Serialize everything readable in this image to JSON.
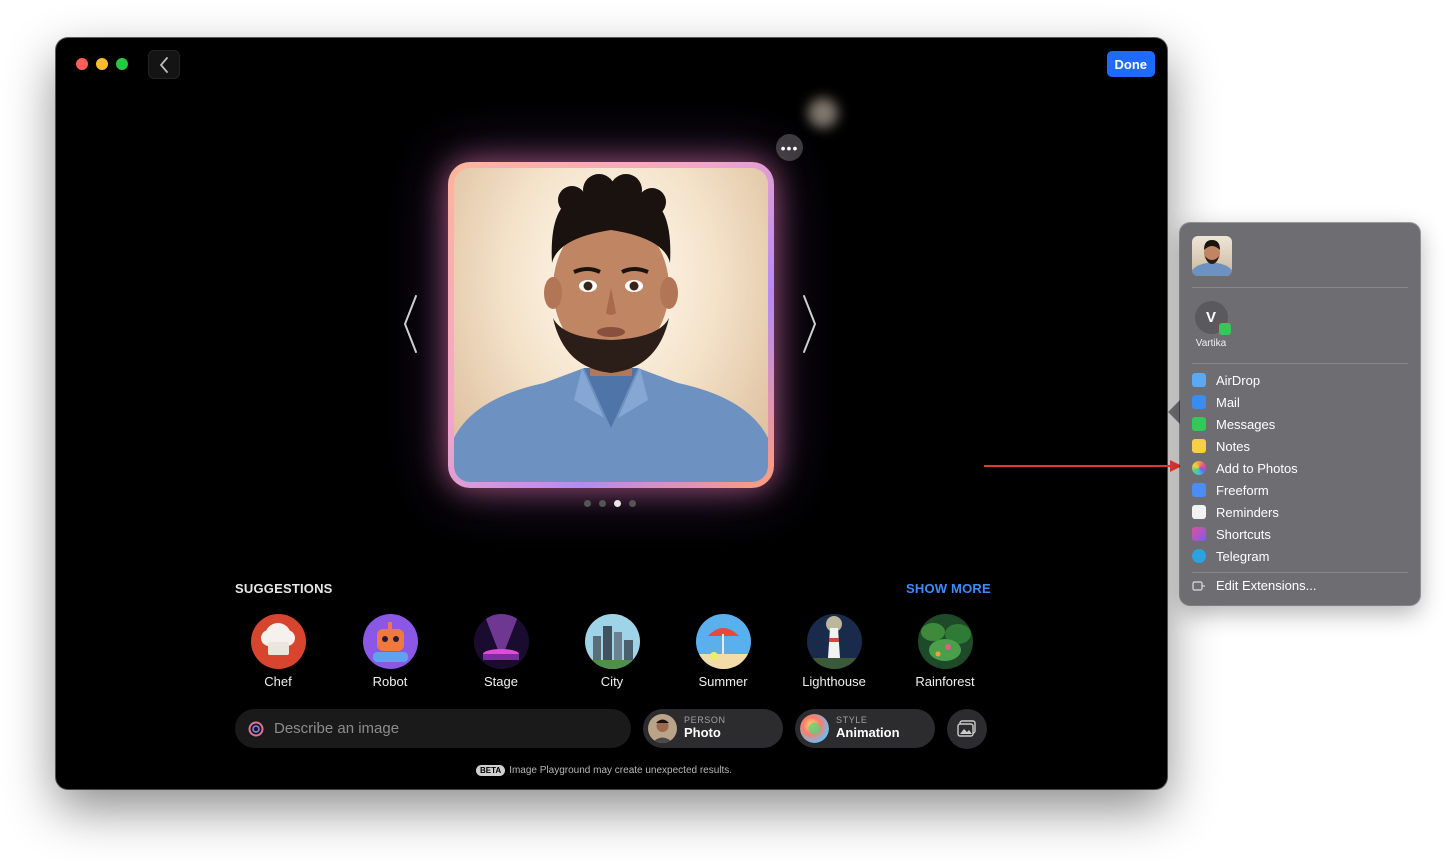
{
  "toolbar": {
    "done_label": "Done"
  },
  "suggestions": {
    "title": "SUGGESTIONS",
    "show_more": "SHOW MORE",
    "items": [
      {
        "label": "Chef",
        "icon": "chef-hat-icon"
      },
      {
        "label": "Robot",
        "icon": "robot-icon"
      },
      {
        "label": "Stage",
        "icon": "stage-icon"
      },
      {
        "label": "City",
        "icon": "city-icon"
      },
      {
        "label": "Summer",
        "icon": "beach-umbrella-icon"
      },
      {
        "label": "Lighthouse",
        "icon": "lighthouse-icon"
      },
      {
        "label": "Rainforest",
        "icon": "rainforest-icon"
      }
    ]
  },
  "prompt": {
    "placeholder": "Describe an image"
  },
  "person_chip": {
    "small": "PERSON",
    "big": "Photo"
  },
  "style_chip": {
    "small": "STYLE",
    "big": "Animation"
  },
  "beta": {
    "badge": "BETA",
    "note": "Image Playground may create unexpected results."
  },
  "pager": {
    "count": 4,
    "active_index": 2
  },
  "share_menu": {
    "contact": {
      "initial": "V",
      "name": "Vartika"
    },
    "items": [
      {
        "label": "AirDrop",
        "color": "#5aa9f5"
      },
      {
        "label": "Mail",
        "color": "#3a8cf0"
      },
      {
        "label": "Messages",
        "color": "#34c759"
      },
      {
        "label": "Notes",
        "color": "#f5d046"
      },
      {
        "label": "Add to Photos",
        "color": "#f19a3e"
      },
      {
        "label": "Freeform",
        "color": "#4c8df5"
      },
      {
        "label": "Reminders",
        "color": "#f2f2f2"
      },
      {
        "label": "Shortcuts",
        "color": "#7b5cf0"
      },
      {
        "label": "Telegram",
        "color": "#2aa3e0"
      }
    ],
    "edit_extensions": "Edit Extensions..."
  },
  "colors": {
    "accent": "#1f6bff",
    "link": "#3c8cff",
    "annotation_arrow": "#e03a2f"
  }
}
